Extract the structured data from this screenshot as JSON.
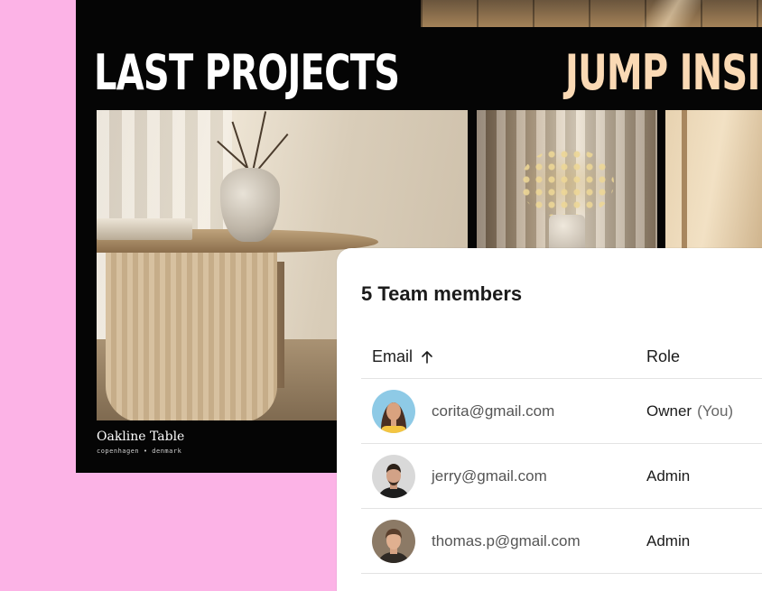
{
  "portfolio": {
    "heading_left": "LAST PROJECTS",
    "heading_right": "JUMP INSI",
    "main_project": {
      "title": "Oakline Table",
      "subtitle": "copenhagen • denmark"
    }
  },
  "team": {
    "title": "5 Team members",
    "columns": {
      "email": "Email",
      "role": "Role"
    },
    "sort_icon": "arrow-up-icon",
    "members": [
      {
        "email": "corita@gmail.com",
        "role": "Owner",
        "note": "(You)",
        "avatar_bg": "#8ecae6"
      },
      {
        "email": "jerry@gmail.com",
        "role": "Admin",
        "note": "",
        "avatar_bg": "#d9d9d9"
      },
      {
        "email": "thomas.p@gmail.com",
        "role": "Admin",
        "note": "",
        "avatar_bg": "#8c7a66"
      }
    ]
  },
  "colors": {
    "page_background": "#fcb3e6",
    "panel_background": "#050505",
    "heading_accent": "#fad9b4"
  }
}
